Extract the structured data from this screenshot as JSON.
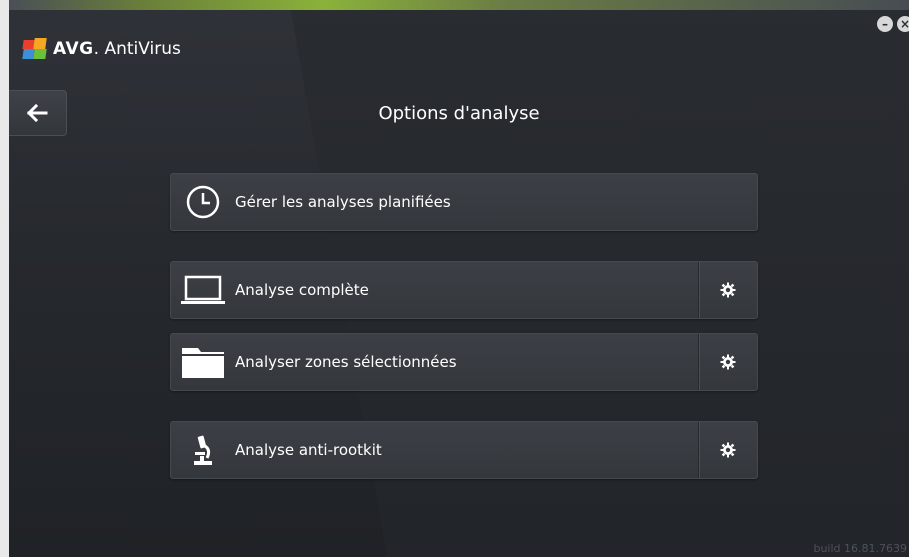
{
  "app": {
    "brand": "AVG",
    "product": "AntiVirus",
    "build": "build 16.81.7639"
  },
  "window": {
    "minimize_icon": "minimize-icon",
    "close_icon": "close-icon"
  },
  "page": {
    "title": "Options d'analyse",
    "back_icon": "arrow-left-icon"
  },
  "options": [
    {
      "label": "Gérer les analyses planifiées",
      "icon": "clock-icon",
      "has_settings": false
    },
    {
      "label": "Analyse complète",
      "icon": "laptop-icon",
      "has_settings": true
    },
    {
      "label": "Analyser zones sélectionnées",
      "icon": "folder-icon",
      "has_settings": true
    },
    {
      "label": "Analyse anti-rootkit",
      "icon": "microscope-icon",
      "has_settings": true
    }
  ],
  "colors": {
    "background": "#26292e",
    "accent_green": "#8ab23a",
    "text": "#ffffff"
  }
}
